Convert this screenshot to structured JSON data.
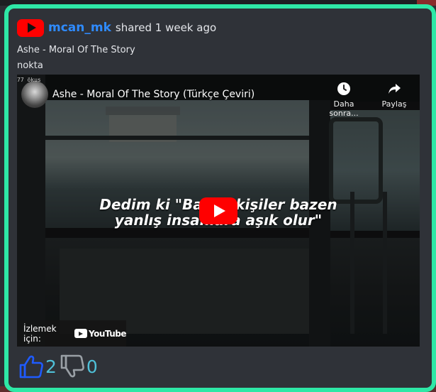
{
  "post": {
    "username": "mcan_mk",
    "shared_text": "shared 1 week ago",
    "title": "Ashe - Moral Of The Story",
    "note": "nokta"
  },
  "video": {
    "title": "Ashe - Moral Of The Story (Türkçe Çeviri)",
    "channel_tag": "77 ökus",
    "watch_later_label": "Daha sonra...",
    "share_label": "Paylaş",
    "lyric_line1": "Dedim ki \"Bazen kişiler bazen",
    "lyric_line2": "yanlış insanlara aşık olur\"",
    "watch_on_label": "İzlemek için:",
    "youtube_wordmark": "YouTube"
  },
  "votes": {
    "likes": "2",
    "dislikes": "0"
  },
  "colors": {
    "border": "#2ee8a6",
    "username": "#2f8bff",
    "youtube_red": "#ff0000",
    "like_icon": "#1f5bff",
    "dislike_icon": "#9aa0a6",
    "vote_count": "#4fc0d8"
  },
  "icons": [
    "youtube-logo-icon",
    "clock-icon",
    "share-arrow-icon",
    "play-icon",
    "youtube-wordmark-icon",
    "thumbs-up-icon",
    "thumbs-down-icon"
  ]
}
